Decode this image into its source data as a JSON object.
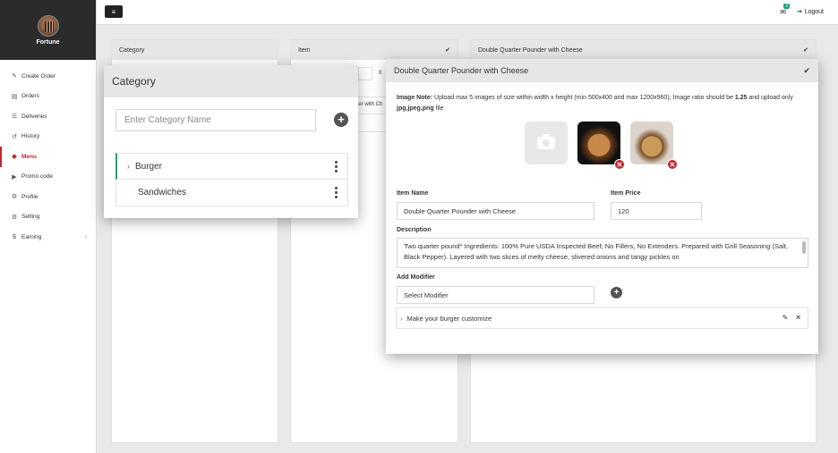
{
  "brand": {
    "name": "Fortune"
  },
  "sidebar": {
    "items": [
      {
        "label": "Create Order",
        "icon": "✎"
      },
      {
        "label": "Orders",
        "icon": "▤"
      },
      {
        "label": "Deliveries",
        "icon": "☰"
      },
      {
        "label": "History",
        "icon": "↺"
      },
      {
        "label": "Menu",
        "icon": "◆"
      },
      {
        "label": "Promo code",
        "icon": "▶"
      },
      {
        "label": "Profile",
        "icon": "⚙"
      },
      {
        "label": "Setting",
        "icon": "⚙"
      },
      {
        "label": "Earning",
        "icon": "$",
        "caret": "‹"
      }
    ]
  },
  "topbar": {
    "menu_icon": "≡",
    "mail_icon": "✉",
    "mail_badge": "3",
    "logout_icon": "⇥",
    "logout": "Logout"
  },
  "panels": {
    "category": "Category",
    "item": "Item",
    "detail": "Double Quarter Pounder with Cheese",
    "check": "✔",
    "item_partial": "der with Ch",
    "item_value": "0"
  },
  "category_popup": {
    "title": "Category",
    "placeholder": "Enter Category Name",
    "add": "+",
    "rows": [
      {
        "label": "Burger",
        "chevron": "›"
      },
      {
        "label": "Sandwiches"
      }
    ]
  },
  "item_popup": {
    "title": "Double Quarter Pounder with Cheese",
    "check": "✔",
    "note_label": "Image Note:",
    "note_text_1": " Upload max 5 images of size within width x height (min 500x400 and max 1200x960), Image ratio should be ",
    "note_ratio": "1.25",
    "note_text_2": " and upload only ",
    "note_types": "jpg,jpeg,png",
    "note_text_3": " file",
    "delete_icon": "✕",
    "item_name_label": "Item Name",
    "item_name": "Double Quarter Pounder with Cheese",
    "item_price_label": "Item Price",
    "item_price": "120",
    "description_label": "Description",
    "description": "Two quarter pound* Ingredients: 100% Pure USDA Inspected Beef; No Fillers, No Extenders. Prepared with Grill Seasoning (Salt, Black Pepper). Layered with two slices of melty cheese, slivered onions and tangy pickles on",
    "modifier_label": "Add Modifier",
    "modifier_select": "Select Modifier",
    "modifier_add": "+",
    "modifier_row": "Make your burger customize",
    "modifier_chevron": "›",
    "edit_icon": "✎",
    "remove_icon": "✕"
  },
  "colors": {
    "accent": "#c0282e",
    "green": "#1aa37b",
    "header": "#e6e6e6",
    "sidebar_top": "#2b2b2b"
  }
}
